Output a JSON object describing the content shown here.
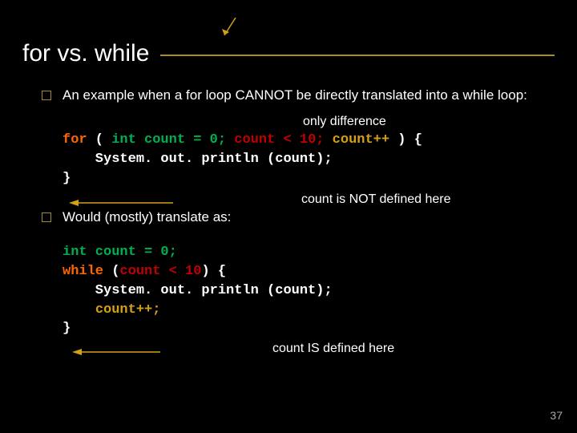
{
  "title": "for vs. while",
  "bullet1_a": "An example when a for loop CANNOT be directly translated into a while loop:",
  "ann_only_diff": "only difference",
  "code1": {
    "l1a": "for",
    "l1b": " ( ",
    "l1c": "int count = 0;",
    "l1d": " ",
    "l1e": "count < 10;",
    "l1f": " ",
    "l1g": "count++",
    "l1h": " ) {",
    "l2": "    System. out. println (count);",
    "l3": "}"
  },
  "ann_not_defined": "count is NOT defined here",
  "bullet2": "Would (mostly) translate as:",
  "code2": {
    "l1": "int count = 0;",
    "l2a": "while",
    "l2b": " (",
    "l2c": "count < 10",
    "l2d": ") {",
    "l3": "    System. out. println (count);",
    "l4a": "    ",
    "l4b": "count++;",
    "l5": "}"
  },
  "ann_is_defined": "count IS defined here",
  "page": "37"
}
